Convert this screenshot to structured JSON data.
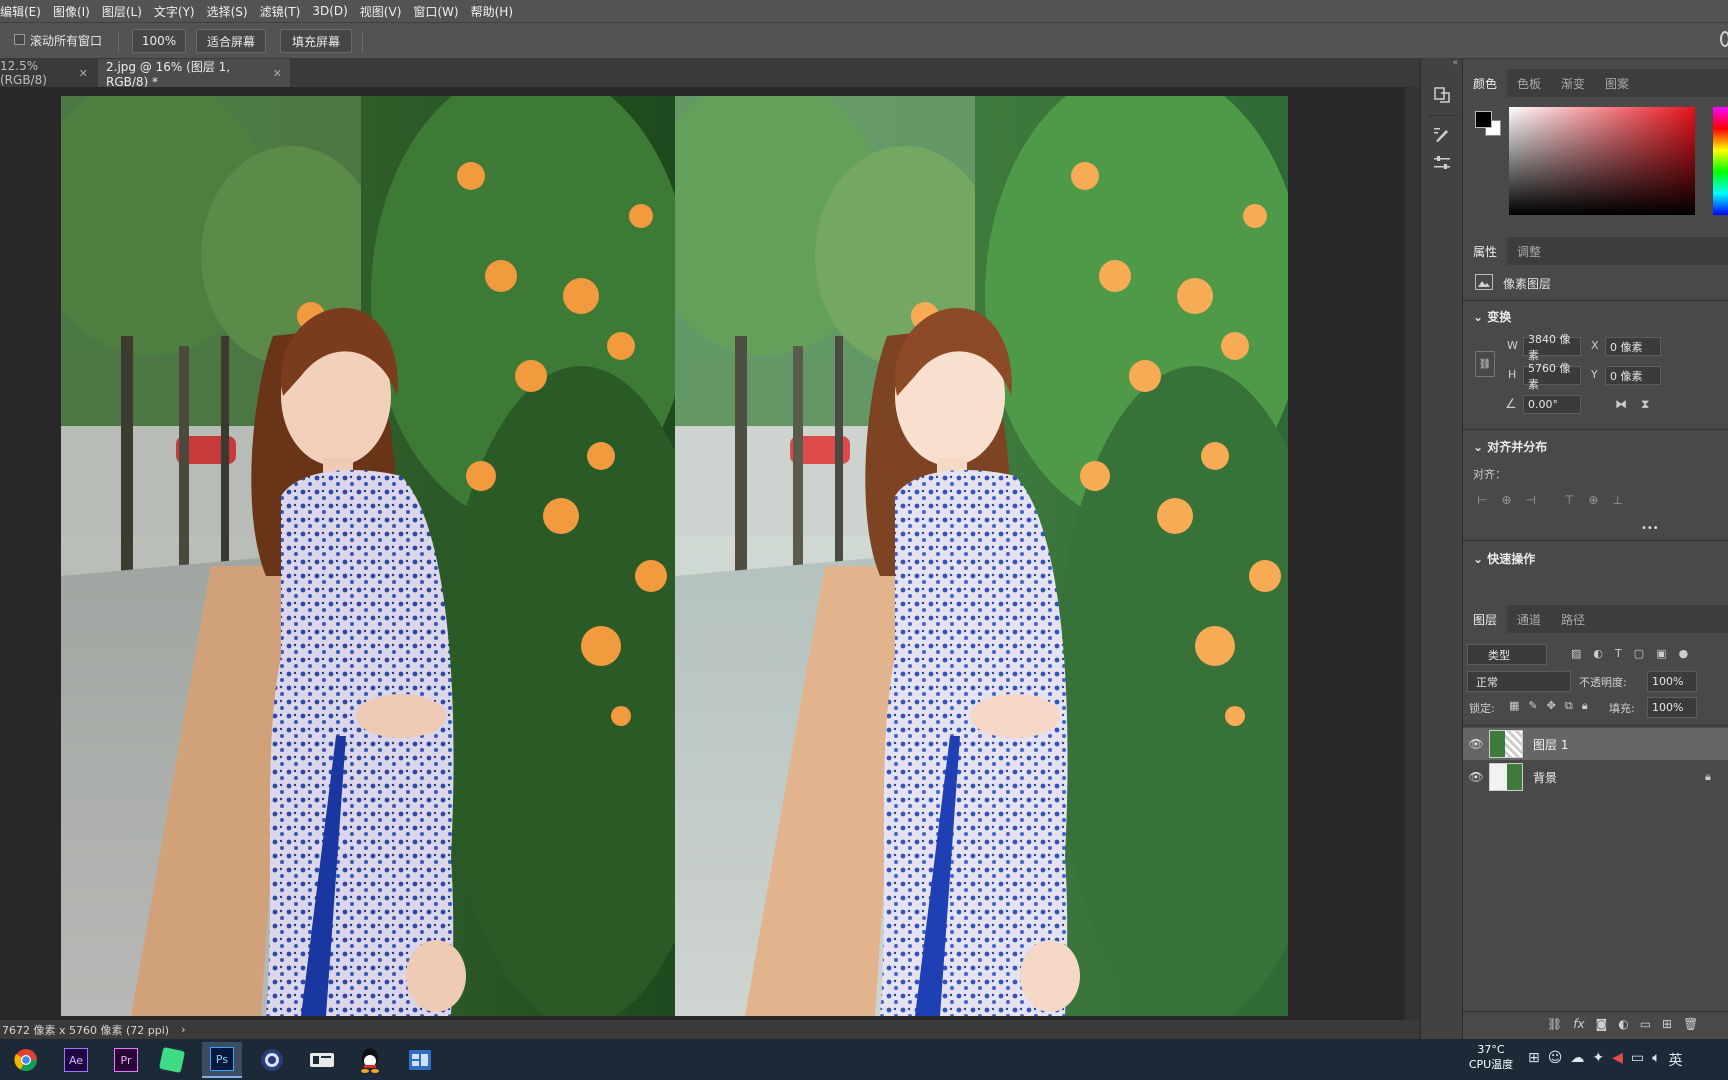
{
  "menu": [
    "编辑(E)",
    "图像(I)",
    "图层(L)",
    "文字(Y)",
    "选择(S)",
    "滤镜(T)",
    "3D(D)",
    "视图(V)",
    "窗口(W)",
    "帮助(H)"
  ],
  "options_bar": {
    "scroll_all_label": "滚动所有窗口",
    "zoom_value": "100%",
    "fit_screen_label": "适合屏幕",
    "fill_screen_label": "填充屏幕"
  },
  "tabs": [
    {
      "label": "12.5%(RGB/8)",
      "active": false
    },
    {
      "label": "2.jpg @ 16% (图层 1, RGB/8) *",
      "active": true
    }
  ],
  "status_bar": {
    "info": "7672 像素 x 5760 像素 (72 ppi)",
    "arrow": "›"
  },
  "color_panel": {
    "tabs": [
      "颜色",
      "色板",
      "渐变",
      "图案"
    ],
    "foreground": "#000000",
    "background": "#ffffff",
    "hue_color": "#e8121b"
  },
  "properties_panel": {
    "tabs": [
      "属性",
      "调整"
    ],
    "layer_type": "像素图层",
    "transform_heading": "变换",
    "w_label": "W",
    "w_value": "3840 像素",
    "h_label": "H",
    "h_value": "5760 像素",
    "x_label": "X",
    "x_value": "0 像素",
    "y_label": "Y",
    "y_value": "0 像素",
    "angle_value": "0.00°",
    "align_heading": "对齐并分布",
    "align_label": "对齐：",
    "more": "•••",
    "quick_heading": "快速操作"
  },
  "layers_panel": {
    "tabs": [
      "图层",
      "通道",
      "路径"
    ],
    "filter_value": "类型",
    "blend_mode": "正常",
    "opacity_label": "不透明度:",
    "opacity_value": "100%",
    "lock_label": "锁定:",
    "fill_label": "填充:",
    "fill_value": "100%",
    "layers": [
      {
        "name": "图层 1",
        "selected": true,
        "locked": false
      },
      {
        "name": "背景",
        "selected": false,
        "locked": true
      }
    ]
  },
  "taskbar": {
    "apps": [
      "chrome-icon",
      "after-effects-icon",
      "premiere-icon",
      "android-studio-icon",
      "photoshop-icon",
      "cinema4d-icon",
      "video-app-icon",
      "qq-icon",
      "app-window-icon"
    ],
    "ae_label": "Ae",
    "pr_label": "Pr",
    "ps_label": "Ps",
    "temperature": "37°C",
    "cpu_label": "CPU温度",
    "ime": "英",
    "grid_label": "⊞"
  }
}
